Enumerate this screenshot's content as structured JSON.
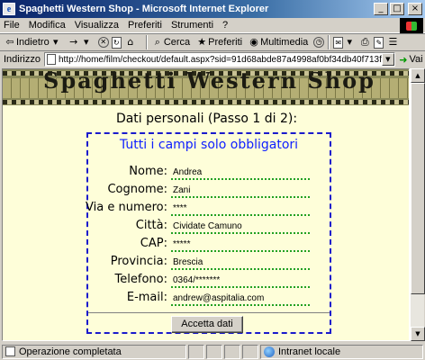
{
  "window": {
    "title": "Spaghetti Western Shop - Microsoft Internet Explorer",
    "minimize": "_",
    "maximize": "□",
    "close": "×"
  },
  "menu": [
    "File",
    "Modifica",
    "Visualizza",
    "Preferiti",
    "Strumenti",
    "?"
  ],
  "toolbar": {
    "back": "Indietro",
    "forward": "→",
    "search": "Cerca",
    "favorites": "Preferiti",
    "media": "Multimedia"
  },
  "address": {
    "label": "Indirizzo",
    "url": "http://home/film/checkout/default.aspx?sid=91d68abde87a4998af0bf34db40f713f",
    "go": "Vai"
  },
  "banner": {
    "text": "Spaghetti Western Shop"
  },
  "page": {
    "heading": "Dati personali (Passo 1 di 2):",
    "form_title": "Tutti i campi solo obbligatori",
    "fields": [
      {
        "label": "Nome:",
        "value": "Andrea"
      },
      {
        "label": "Cognome:",
        "value": "Zani"
      },
      {
        "label": "Via e numero:",
        "value": "****"
      },
      {
        "label": "Città:",
        "value": "Cividate Camuno"
      },
      {
        "label": "CAP:",
        "value": "*****"
      },
      {
        "label": "Provincia:",
        "value": "Brescia"
      },
      {
        "label": "Telefono:",
        "value": "0364/*******"
      },
      {
        "label": "E-mail:",
        "value": "andrew@aspitalia.com"
      }
    ],
    "submit": "Accetta dati"
  },
  "status": {
    "message": "Operazione completata",
    "zone": "Intranet locale"
  },
  "colors": {
    "title_bar": "#0a246a",
    "page_background": "#fefed9",
    "form_border": "#1a1acc",
    "form_title": "#1020ff",
    "field_underline": "#22a022"
  }
}
